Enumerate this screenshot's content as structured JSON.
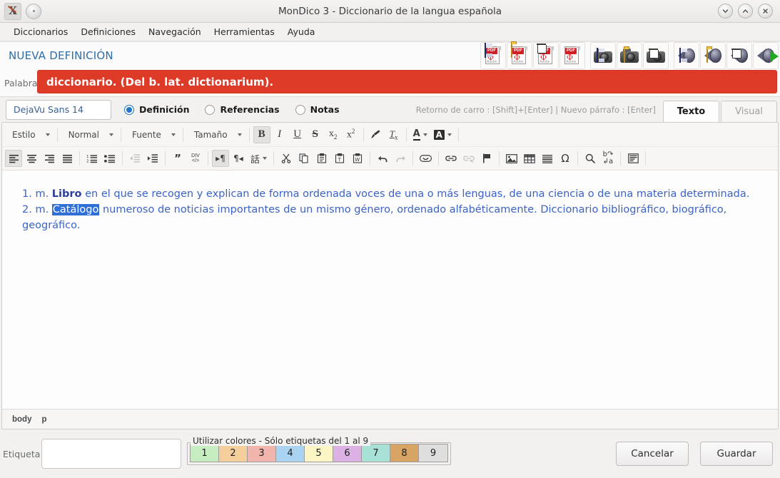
{
  "window": {
    "title": "MonDico 3 - Diccionario de la langua española",
    "controls": {
      "minimize": "minimize-button",
      "maximize": "maximize-button",
      "close": "close-button"
    }
  },
  "menubar": {
    "items": [
      {
        "label": "Diccionarios"
      },
      {
        "label": "Definiciones"
      },
      {
        "label": "Navegación"
      },
      {
        "label": "Herramientas"
      },
      {
        "label": "Ayuda"
      }
    ]
  },
  "header": {
    "page_title": "NUEVA DEFINICIÓN",
    "media_toolbar": [
      {
        "name": "pdf-save-button",
        "icon": "pdf-floppy-icon"
      },
      {
        "name": "pdf-open-button",
        "icon": "pdf-folder-icon"
      },
      {
        "name": "pdf-delete-button",
        "icon": "pdf-trash-icon"
      },
      {
        "name": "pdf-view-button",
        "icon": "pdf-icon"
      },
      {
        "name": "photo-save-button",
        "icon": "camera-floppy-icon"
      },
      {
        "name": "photo-open-button",
        "icon": "camera-folder-icon"
      },
      {
        "name": "photo-delete-button",
        "icon": "camera-trash-icon"
      },
      {
        "name": "audio-save-button",
        "icon": "speaker-floppy-icon"
      },
      {
        "name": "audio-open-button",
        "icon": "speaker-folder-icon"
      },
      {
        "name": "audio-delete-button",
        "icon": "speaker-trash-icon"
      },
      {
        "name": "audio-play-button",
        "icon": "speaker-play-icon"
      }
    ]
  },
  "word": {
    "label": "Palabra",
    "value": "diccionario. (Del b. lat. dictionarium).",
    "bar_color": "#dd3a28"
  },
  "options": {
    "font_value": "DejaVu Sans 14",
    "radios": [
      {
        "label": "Definición",
        "selected": true
      },
      {
        "label": "Referencias",
        "selected": false
      },
      {
        "label": "Notas",
        "selected": false
      }
    ],
    "hint": "Retorno de carro : [Shift]+[Enter] | Nuevo párrafo : [Enter]",
    "tabs": [
      {
        "label": "Texto",
        "active": true
      },
      {
        "label": "Visual",
        "active": false
      }
    ]
  },
  "editor_toolbar": {
    "row1": {
      "combos": [
        {
          "label": "Estilo",
          "name": "style-combo"
        },
        {
          "label": "Normal",
          "name": "paragraph-format-combo"
        },
        {
          "label": "Fuente",
          "name": "font-family-combo"
        },
        {
          "label": "Tamaño",
          "name": "font-size-combo"
        }
      ],
      "buttons": [
        {
          "name": "bold-button",
          "label": "B",
          "state": "on"
        },
        {
          "name": "italic-button",
          "label": "I",
          "state": "off"
        },
        {
          "name": "underline-button",
          "label": "U",
          "state": "off"
        },
        {
          "name": "strikethrough-button",
          "label": "S",
          "state": "off"
        },
        {
          "name": "subscript-button",
          "label": "x₂",
          "state": "off"
        },
        {
          "name": "superscript-button",
          "label": "x²",
          "state": "off"
        },
        {
          "name": "copy-formatting-button",
          "label": "",
          "state": "off"
        },
        {
          "name": "remove-format-button",
          "label": "Tx",
          "state": "off"
        },
        {
          "name": "text-color-button",
          "label": "A",
          "state": "off"
        },
        {
          "name": "background-color-button",
          "label": "A",
          "state": "off"
        }
      ]
    },
    "row2": {
      "buttons": [
        {
          "name": "align-left-button",
          "state": "on"
        },
        {
          "name": "align-center-button",
          "state": "off"
        },
        {
          "name": "align-right-button",
          "state": "off"
        },
        {
          "name": "align-justify-button",
          "state": "off"
        },
        {
          "name": "numbered-list-button",
          "state": "off"
        },
        {
          "name": "bulleted-list-button",
          "state": "off"
        },
        {
          "name": "decrease-indent-button",
          "state": "disabled"
        },
        {
          "name": "increase-indent-button",
          "state": "off"
        },
        {
          "name": "blockquote-button",
          "state": "off"
        },
        {
          "name": "create-div-button",
          "state": "off"
        },
        {
          "name": "text-direction-ltr-button",
          "state": "on"
        },
        {
          "name": "text-direction-rtl-button",
          "state": "off"
        },
        {
          "name": "language-button",
          "label": "話",
          "state": "off"
        },
        {
          "name": "cut-button",
          "state": "off"
        },
        {
          "name": "copy-button",
          "state": "off"
        },
        {
          "name": "paste-button",
          "state": "off"
        },
        {
          "name": "paste-as-text-button",
          "state": "off"
        },
        {
          "name": "paste-from-word-button",
          "state": "off"
        },
        {
          "name": "undo-button",
          "state": "off"
        },
        {
          "name": "redo-button",
          "state": "disabled"
        },
        {
          "name": "smiley-button",
          "state": "off"
        },
        {
          "name": "link-button",
          "state": "off"
        },
        {
          "name": "unlink-button",
          "state": "disabled"
        },
        {
          "name": "anchor-button",
          "state": "off"
        },
        {
          "name": "image-button",
          "state": "off"
        },
        {
          "name": "table-button",
          "state": "off"
        },
        {
          "name": "horizontal-rule-button",
          "state": "off"
        },
        {
          "name": "special-character-button",
          "label": "Ω",
          "state": "off"
        },
        {
          "name": "find-button",
          "state": "off"
        },
        {
          "name": "replace-button",
          "state": "off"
        },
        {
          "name": "templates-button",
          "state": "off"
        }
      ]
    }
  },
  "document": {
    "lines": [
      {
        "prefix": "1. m. ",
        "bold": "Libro",
        "rest": " en el que se recogen y explican de forma ordenada voces de una o más lenguas, de una ciencia o de una materia determinada."
      },
      {
        "prefix": "2. m. ",
        "selected": "Catálogo",
        "rest": " numeroso de noticias importantes de un mismo género, ordenado alfabéticamente. Diccionario bibliográfico, biográfico, geográfico."
      }
    ],
    "text_color": "#3c63c4",
    "selection_color": "#2f6fd8"
  },
  "statusbar": {
    "path": [
      "body",
      "p"
    ]
  },
  "bottom": {
    "tag_label": "Etiqueta",
    "tag_value": "",
    "colors_legend": "Utilizar colores - Sólo etiquetas del 1 al 9",
    "color_cells": [
      {
        "label": "1",
        "color": "#c6edc0"
      },
      {
        "label": "2",
        "color": "#f4cf9b"
      },
      {
        "label": "3",
        "color": "#f2b5ae"
      },
      {
        "label": "4",
        "color": "#a9d3f0"
      },
      {
        "label": "5",
        "color": "#fbf6c4"
      },
      {
        "label": "6",
        "color": "#dcb2e4"
      },
      {
        "label": "7",
        "color": "#a8e2d6"
      },
      {
        "label": "8",
        "color": "#d8a463"
      },
      {
        "label": "9",
        "color": "#dedede"
      }
    ],
    "cancel_label": "Cancelar",
    "save_label": "Guardar"
  }
}
